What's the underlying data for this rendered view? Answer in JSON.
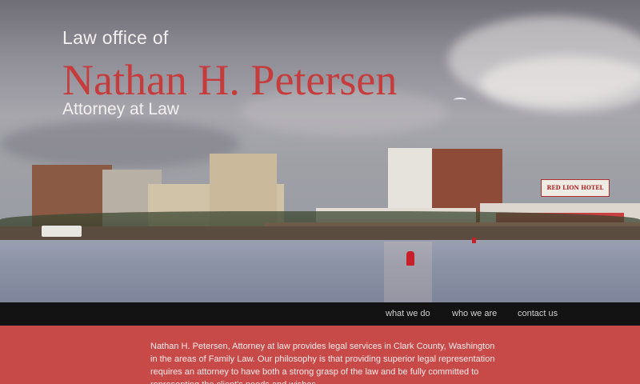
{
  "header": {
    "pre_title": "Law office of",
    "title": "Nathan H. Petersen",
    "subtitle": "Attorney at Law"
  },
  "hero": {
    "hotel_sign": "RED LION HOTEL"
  },
  "nav": {
    "items": [
      "what we do",
      "who we are",
      "contact us"
    ]
  },
  "main": {
    "intro": "Nathan H. Petersen, Attorney at law provides legal services in Clark County, Washington in the areas of Family Law. Our philosophy is that providing superior legal representation requires an attorney to have both a strong grasp of the law and be fully committed to representing the client's needs and wishes."
  },
  "colors": {
    "accent": "#c63c3c",
    "content_bg": "#c84a48",
    "nav_bg": "#131313"
  }
}
